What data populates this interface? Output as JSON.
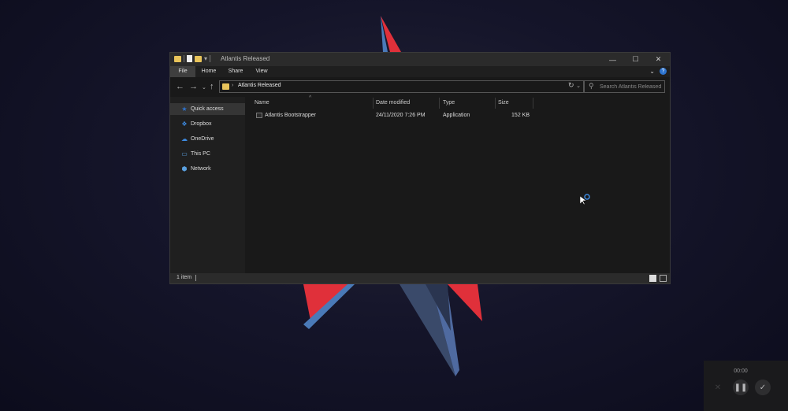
{
  "window": {
    "title": "Atlantis Released",
    "controls": {
      "minimize": "—",
      "maximize": "☐",
      "close": "✕"
    }
  },
  "ribbon": {
    "tabs": [
      "File",
      "Home",
      "Share",
      "View"
    ],
    "active_tab": "File"
  },
  "address": {
    "path": "Atlantis Released",
    "search_placeholder": "Search Atlantis Released"
  },
  "sidebar": {
    "items": [
      {
        "label": "Quick access",
        "icon": "star-icon",
        "selected": true
      },
      {
        "label": "Dropbox",
        "icon": "dropbox-icon"
      },
      {
        "label": "OneDrive",
        "icon": "cloud-icon"
      },
      {
        "label": "This PC",
        "icon": "computer-icon"
      },
      {
        "label": "Network",
        "icon": "network-icon"
      }
    ]
  },
  "table": {
    "columns": [
      "Name",
      "Date modified",
      "Type",
      "Size"
    ],
    "rows": [
      {
        "name": "Atlantis Bootstrapper",
        "date": "24/11/2020 7:26 PM",
        "type": "Application",
        "size": "152 KB"
      }
    ]
  },
  "status": {
    "count": "1 item"
  },
  "recorder": {
    "time": "00:00"
  },
  "colors": {
    "accent": "#2d74d0",
    "folder": "#e8c45b",
    "wallpaper_red": "#e0303a",
    "wallpaper_blue": "#4a7ab8"
  }
}
